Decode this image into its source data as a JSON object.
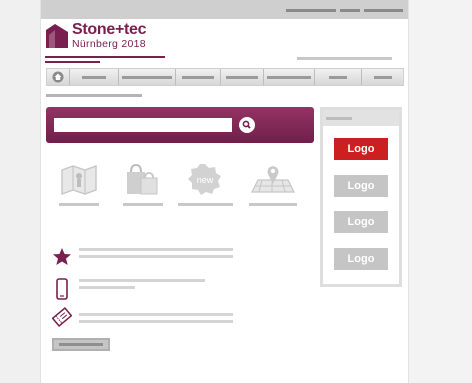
{
  "header": {
    "brand_name": "Stone+tec",
    "brand_sub": "Nürnberg 2018"
  },
  "sidebar": {
    "logo_buttons": [
      {
        "label": "Logo",
        "state": "active",
        "color": "#cc1f1f"
      },
      {
        "label": "Logo",
        "state": "inactive",
        "color": "#c5c5c5"
      },
      {
        "label": "Logo",
        "state": "inactive",
        "color": "#c5c5c5"
      },
      {
        "label": "Logo",
        "state": "inactive",
        "color": "#c5c5c5"
      }
    ]
  },
  "features": {
    "icons": [
      "map-icon",
      "shopping-bags-icon",
      "new-badge-icon",
      "location-map-icon"
    ],
    "badge_text": "new"
  },
  "info_rows": {
    "icons": [
      "star-icon",
      "mobile-phone-icon",
      "ticket-icon"
    ]
  },
  "colors": {
    "brand": "#7a2050",
    "search_bar": "#852a5a",
    "logo_active": "#cc1f1f",
    "logo_inactive": "#c5c5c5"
  }
}
